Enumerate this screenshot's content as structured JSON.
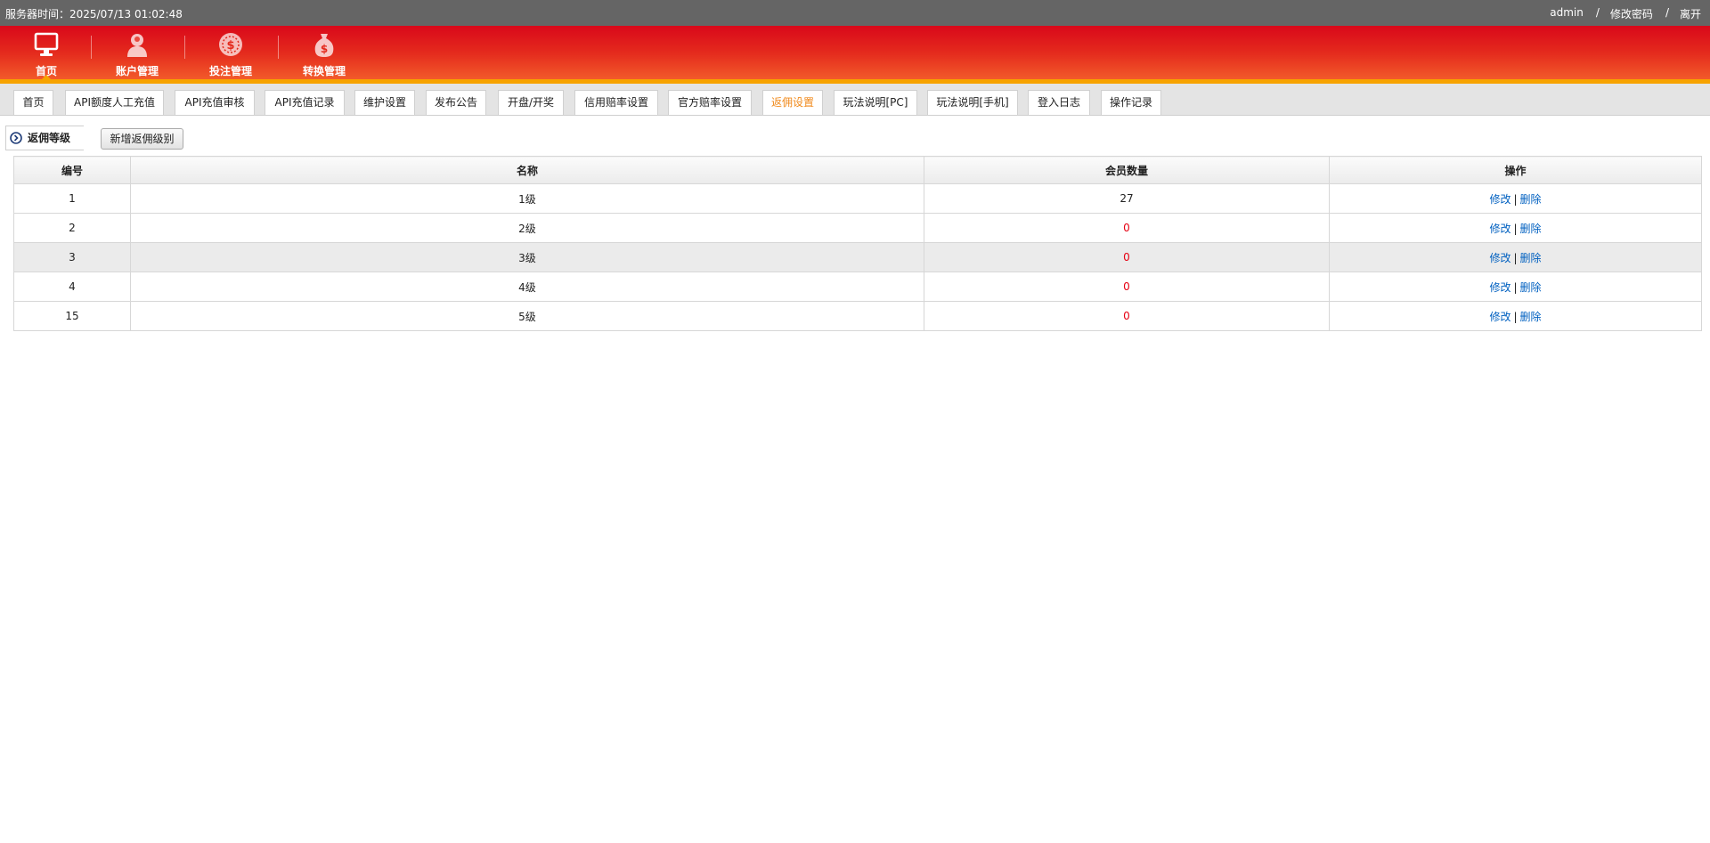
{
  "topbar": {
    "server_time": "服务器时间：2025/07/13 01:02:48",
    "user": "admin",
    "sep1": "/",
    "change_password": "修改密码",
    "sep2": "/",
    "logout": "离开"
  },
  "nav": [
    {
      "label": "首页",
      "icon": "monitor-icon"
    },
    {
      "label": "账户管理",
      "icon": "user-icon"
    },
    {
      "label": "投注管理",
      "icon": "coin-icon"
    },
    {
      "label": "转换管理",
      "icon": "money-bag-icon"
    }
  ],
  "tabs": [
    "首页",
    "API额度人工充值",
    "API充值审核",
    "API充值记录",
    "维护设置",
    "发布公告",
    "开盘/开奖",
    "信用赔率设置",
    "官方赔率设置",
    "返佣设置",
    "玩法说明[PC]",
    "玩法说明[手机]",
    "登入日志",
    "操作记录"
  ],
  "active_tab": "返佣设置",
  "toolbar": {
    "section_label": "返佣等级",
    "add_button": "新增返佣级别"
  },
  "table": {
    "headers": [
      "编号",
      "名称",
      "会员数量",
      "操作"
    ],
    "rows": [
      {
        "id": "1",
        "name": "1级",
        "count": "27",
        "edit": "修改",
        "sep": "|",
        "delete": "删除"
      },
      {
        "id": "2",
        "name": "2级",
        "count": "0",
        "edit": "修改",
        "sep": "|",
        "delete": "删除"
      },
      {
        "id": "3",
        "name": "3级",
        "count": "0",
        "edit": "修改",
        "sep": "|",
        "delete": "删除"
      },
      {
        "id": "4",
        "name": "4级",
        "count": "0",
        "edit": "修改",
        "sep": "|",
        "delete": "删除"
      },
      {
        "id": "15",
        "name": "5级",
        "count": "0",
        "edit": "修改",
        "sep": "|",
        "delete": "删除"
      }
    ]
  },
  "colors": {
    "header_red": "#d9081a",
    "accent_orange": "#f7a300",
    "active_tab": "#f08a1c",
    "link_blue": "#0060c0",
    "zero_red": "#e60012"
  }
}
